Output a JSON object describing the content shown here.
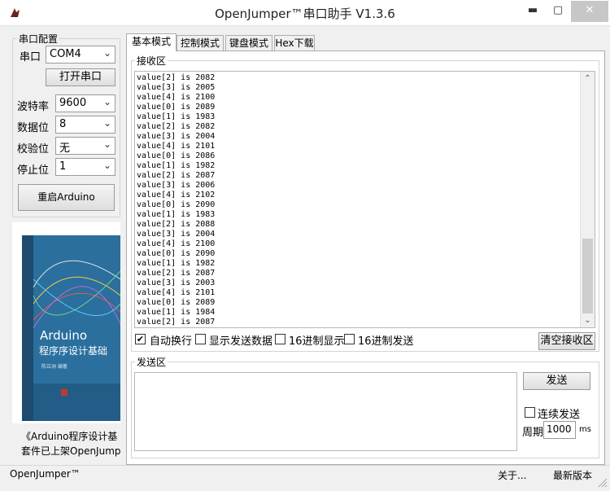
{
  "window": {
    "title": "OpenJumper™串口助手  V1.3.6"
  },
  "serial_config": {
    "group_title": "串口配置",
    "port_label": "串口",
    "port_value": "COM4",
    "open_button": "打开串口",
    "baud_label": "波特率",
    "baud_value": "9600",
    "databits_label": "数据位",
    "databits_value": "8",
    "parity_label": "校验位",
    "parity_value": "无",
    "stopbits_label": "停止位",
    "stopbits_value": "1",
    "restart_button": "重启Arduino"
  },
  "ad": {
    "book_title": "Arduino",
    "book_subtitle": "程序序设计基础",
    "book_author": "陈吕洲  编著",
    "caption_line1": "《Arduino程序设计基",
    "caption_line2": "套件已上架OpenJump"
  },
  "tabs": [
    {
      "label": "基本模式",
      "active": true
    },
    {
      "label": "控制模式",
      "active": false
    },
    {
      "label": "键盘模式",
      "active": false
    },
    {
      "label": "Hex下载",
      "active": false
    }
  ],
  "receive": {
    "group_title": "接收区",
    "lines": [
      "value[2] is 2082",
      "value[3] is 2005",
      "value[4] is 2100",
      "value[0] is 2089",
      "value[1] is 1983",
      "value[2] is 2082",
      "value[3] is 2004",
      "value[4] is 2101",
      "value[0] is 2086",
      "value[1] is 1982",
      "value[2] is 2087",
      "value[3] is 2006",
      "value[4] is 2102",
      "value[0] is 2090",
      "value[1] is 1983",
      "value[2] is 2088",
      "value[3] is 2004",
      "value[4] is 2100",
      "value[0] is 2090",
      "value[1] is 1982",
      "value[2] is 2087",
      "value[3] is 2003",
      "value[4] is 2101",
      "value[0] is 2089",
      "value[1] is 1984",
      "value[2] is 2087"
    ],
    "options": {
      "auto_wrap": {
        "label": "自动换行",
        "checked": true
      },
      "show_sent": {
        "label": "显示发送数据",
        "checked": false
      },
      "hex_display": {
        "label": "16进制显示",
        "checked": false
      },
      "hex_send": {
        "label": "16进制发送",
        "checked": false
      }
    },
    "clear_button": "清空接收区"
  },
  "send": {
    "group_title": "发送区",
    "send_button": "发送",
    "continuous_label": "连续发送",
    "continuous_checked": false,
    "period_label": "周期",
    "period_value": "1000",
    "period_unit": "ms"
  },
  "statusbar": {
    "left": "OpenJumper™",
    "about": "关于...",
    "latest": "最新版本"
  }
}
